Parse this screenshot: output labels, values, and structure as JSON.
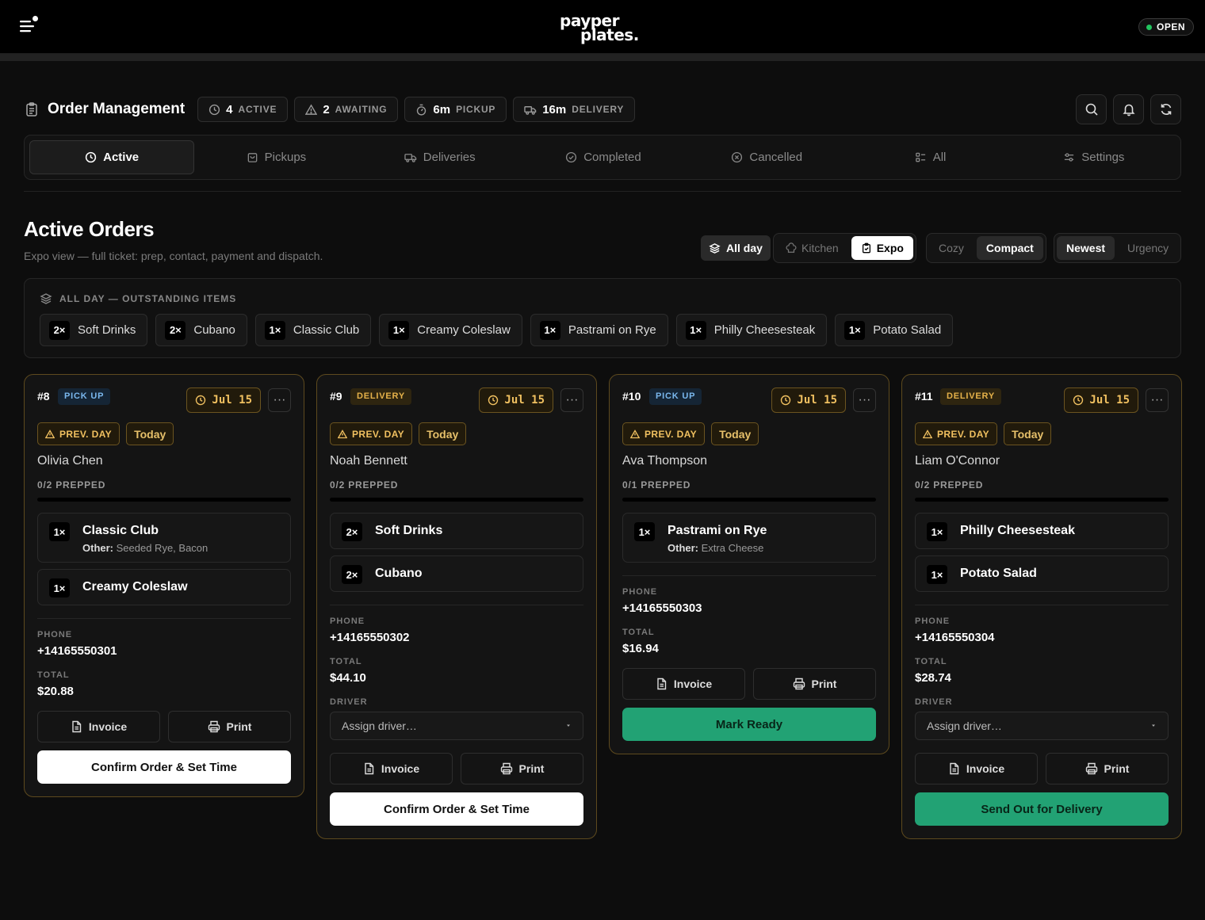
{
  "app": {
    "logo_line1": "payper",
    "logo_line2": "plates.",
    "status": "OPEN"
  },
  "header": {
    "title": "Order Management",
    "stats": [
      {
        "value": "4",
        "label": "ACTIVE"
      },
      {
        "value": "2",
        "label": "AWAITING"
      },
      {
        "value": "6m",
        "label": "PICKUP"
      },
      {
        "value": "16m",
        "label": "DELIVERY"
      }
    ]
  },
  "tabs": [
    "Active",
    "Pickups",
    "Deliveries",
    "Completed",
    "Cancelled",
    "All",
    "Settings"
  ],
  "section": {
    "title": "Active Orders",
    "subtitle": "Expo view — full ticket: prep, contact, payment and dispatch."
  },
  "views": {
    "all_day": "All day",
    "station": [
      "Kitchen",
      "Expo"
    ],
    "density": [
      "Cozy",
      "Compact"
    ],
    "sort": [
      "Newest",
      "Urgency"
    ]
  },
  "all_day_panel": {
    "title": "ALL DAY — OUTSTANDING ITEMS",
    "items": [
      {
        "qty": "2×",
        "name": "Soft Drinks"
      },
      {
        "qty": "2×",
        "name": "Cubano"
      },
      {
        "qty": "1×",
        "name": "Classic Club"
      },
      {
        "qty": "1×",
        "name": "Creamy Coleslaw"
      },
      {
        "qty": "1×",
        "name": "Pastrami on Rye"
      },
      {
        "qty": "1×",
        "name": "Philly Cheesesteak"
      },
      {
        "qty": "1×",
        "name": "Potato Salad"
      }
    ]
  },
  "labels": {
    "prev_day": "PREV. DAY",
    "today": "Today",
    "phone": "PHONE",
    "total": "TOTAL",
    "driver": "DRIVER",
    "invoice": "Invoice",
    "print": "Print",
    "more": "···"
  },
  "orders": [
    {
      "number": "#8",
      "type": "PICK UP",
      "date": "Jul 15",
      "customer": "Olivia Chen",
      "prepped": "0/2 PREPPED",
      "prep_fraction": 0,
      "items": [
        {
          "qty": "1×",
          "name": "Classic Club",
          "mod_label": "Other:",
          "mod_value": "Seeded Rye, Bacon"
        },
        {
          "qty": "1×",
          "name": "Creamy Coleslaw"
        }
      ],
      "phone": "+14165550301",
      "total": "$20.88",
      "action": "Confirm Order & Set Time"
    },
    {
      "number": "#9",
      "type": "DELIVERY",
      "date": "Jul 15",
      "customer": "Noah Bennett",
      "prepped": "0/2 PREPPED",
      "prep_fraction": 0,
      "items": [
        {
          "qty": "2×",
          "name": "Soft Drinks"
        },
        {
          "qty": "2×",
          "name": "Cubano"
        }
      ],
      "phone": "+14165550302",
      "total": "$44.10",
      "driver_placeholder": "Assign driver…",
      "action": "Confirm Order & Set Time"
    },
    {
      "number": "#10",
      "type": "PICK UP",
      "date": "Jul 15",
      "customer": "Ava Thompson",
      "prepped": "0/1 PREPPED",
      "prep_fraction": 0,
      "items": [
        {
          "qty": "1×",
          "name": "Pastrami on Rye",
          "mod_label": "Other:",
          "mod_value": "Extra Cheese"
        }
      ],
      "phone": "+14165550303",
      "total": "$16.94",
      "action": "Mark Ready"
    },
    {
      "number": "#11",
      "type": "DELIVERY",
      "date": "Jul 15",
      "customer": "Liam O'Connor",
      "prepped": "0/2 PREPPED",
      "prep_fraction": 0,
      "items": [
        {
          "qty": "1×",
          "name": "Philly Cheesesteak"
        },
        {
          "qty": "1×",
          "name": "Potato Salad"
        }
      ],
      "phone": "+14165550304",
      "total": "$28.74",
      "driver_placeholder": "Assign driver…",
      "action": "Send Out for Delivery"
    }
  ],
  "colors": {
    "accent_green": "#22a274",
    "amber": "#f0c060",
    "pickup_blue": "#7ab8ee"
  }
}
